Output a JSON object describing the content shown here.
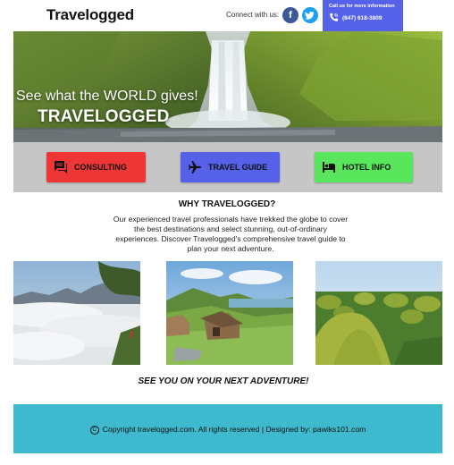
{
  "header": {
    "brand": "Travelogged",
    "connect_label": "Connect with us:",
    "social": [
      {
        "name": "facebook",
        "glyph": "f",
        "color": "#3b5998"
      },
      {
        "name": "twitter",
        "glyph": "t",
        "color": "#1da1f2"
      }
    ],
    "call": {
      "info": "Call us for more information",
      "phone": "(847) 618-3809",
      "background": "#5461e8"
    }
  },
  "hero": {
    "tagline": "See what the WORLD gives!",
    "title": "TRAVELOGGED"
  },
  "buttons": [
    {
      "label": "CONSULTING",
      "icon": "chat-icon",
      "color": "#ef3636"
    },
    {
      "label": "TRAVEL GUIDE",
      "icon": "airplane-icon",
      "color": "#5461e8"
    },
    {
      "label": "HOTEL INFO",
      "icon": "hotel-bed-icon",
      "color": "#59e65c"
    }
  ],
  "why": {
    "title": "WHY TRAVELOGGED?",
    "body": "Our experienced travel professionals have trekked the globe to cover the best destinations and select stunning, out-of-ordinary experiences. Discover Travelogged's comprehensive travel guide to plan your next adventure."
  },
  "gallery": [
    {
      "subject": "sea-of-clouds-mountain-photo"
    },
    {
      "subject": "hillside-village-photo"
    },
    {
      "subject": "chocolate-hills-photo"
    }
  ],
  "closing": "SEE YOU ON YOUR NEXT ADVENTURE!",
  "footer": {
    "copyright": "Copyright travelogged.com. All rights reserved | Designed by: pawiks101.com",
    "background": "#3fb9cd"
  }
}
